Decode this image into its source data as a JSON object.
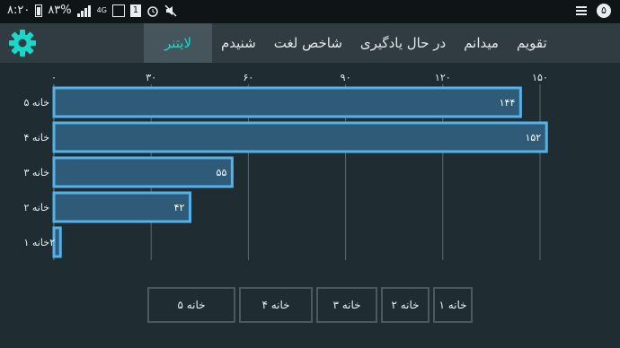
{
  "status_bar": {
    "time": "۸:۲۰",
    "battery": "۸۳%",
    "network": "4G",
    "notification_count": "۵",
    "icons": [
      "battery-icon",
      "signal-icon",
      "4g-icon",
      "image-icon",
      "sim-1-icon",
      "alarm-icon",
      "mute-icon",
      "checklist-icon",
      "notification-badge-icon"
    ]
  },
  "tabs": [
    {
      "label": "لایتنر",
      "active": true
    },
    {
      "label": "شنیدم",
      "active": false
    },
    {
      "label": "شاخص لغت",
      "active": false
    },
    {
      "label": "در حال یادگیری",
      "active": false
    },
    {
      "label": "میدانم",
      "active": false
    },
    {
      "label": "تقویم",
      "active": false
    }
  ],
  "settings_icon": "gear-icon",
  "chart_data": {
    "type": "bar",
    "orientation": "horizontal",
    "categories": [
      "خانه ۵",
      "خانه ۴",
      "خانه ۳",
      "خانه ۲",
      "خانه ۱"
    ],
    "values": [
      144,
      152,
      55,
      42,
      2
    ],
    "value_labels": [
      "۱۴۴",
      "۱۵۲",
      "۵۵",
      "۴۲",
      "۲"
    ],
    "xlim": [
      0,
      150
    ],
    "xticks": [
      0,
      30,
      60,
      90,
      120,
      150
    ],
    "xtick_labels": [
      "۰",
      "۳۰",
      "۶۰",
      "۹۰",
      "۱۲۰",
      "۱۵۰"
    ],
    "x_axis_position": "top",
    "grid": true,
    "colors": {
      "bar_fill": "#2f5b79",
      "bar_stroke": "#54b2ea",
      "grid": "#5b6a70",
      "background": "#1f2d33"
    }
  },
  "legend": [
    "خانه ۵",
    "خانه ۴",
    "خانه ۳",
    "خانه ۲",
    "خانه ۱"
  ]
}
